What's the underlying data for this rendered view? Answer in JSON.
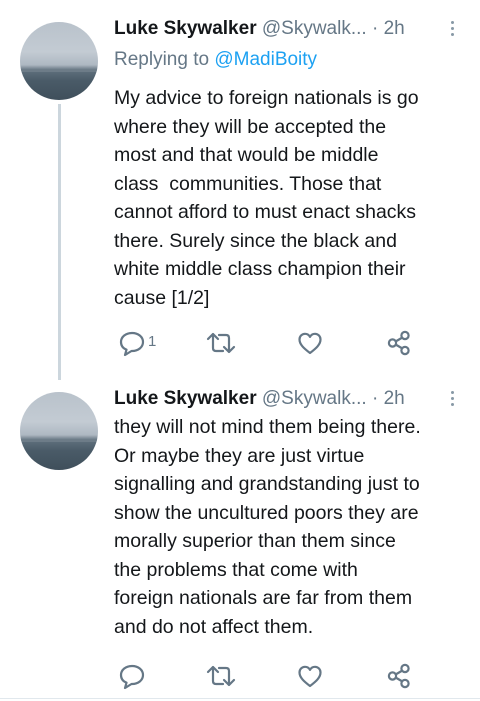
{
  "tweets": [
    {
      "name": "Luke Skywalker",
      "handle": "@Skywalk...",
      "separator": "·",
      "time": "2h",
      "replying_prefix": "Replying to ",
      "replying_handle": "@MadiBoity",
      "lines": [
        "My advice to foreign nationals is go",
        "where they will be accepted the",
        "most and that would be middle",
        "class  communities. Those that",
        "cannot afford to must enact shacks",
        "there. Surely since the black and",
        "white middle class champion their",
        "cause [1/2]"
      ],
      "actions": {
        "reply_count": "1"
      }
    },
    {
      "name": "Luke Skywalker",
      "handle": "@Skywalk...",
      "separator": "·",
      "time": "2h",
      "lines": [
        "they will not mind them being there.",
        "Or maybe they are just virtue",
        "signalling and grandstanding just to",
        "show the uncultured poors they are",
        "morally superior than them since",
        "the problems that come with",
        "foreign nationals are far from them",
        "and do not affect them."
      ],
      "actions": {
        "reply_count": ""
      }
    }
  ],
  "icons": {
    "avatar": "sea-horizon-photo",
    "more": "vertical-dots-icon",
    "reply": "speech-bubble-icon",
    "retweet": "retweet-arrows-icon",
    "like": "heart-outline-icon",
    "share": "share-nodes-icon"
  },
  "colors": {
    "text": "#14171a",
    "secondary": "#657786",
    "link": "#1da1f2",
    "thread_line": "#ccd6dd",
    "icon": "#657786"
  }
}
